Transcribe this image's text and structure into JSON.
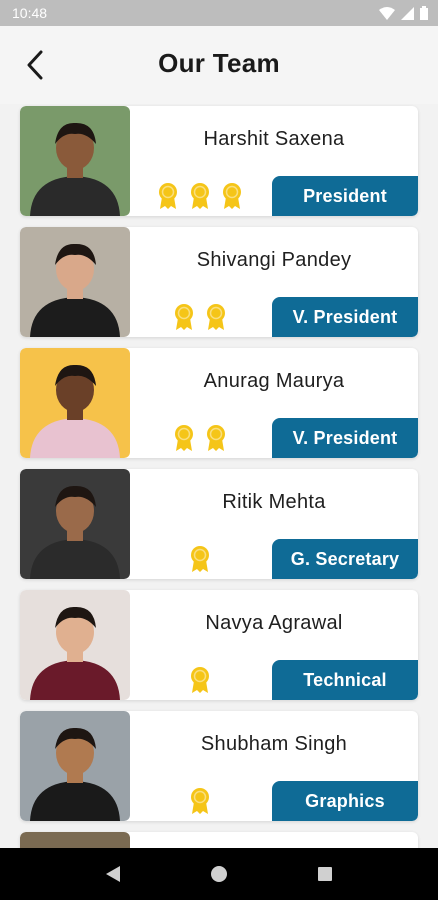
{
  "status_bar": {
    "time": "10:48"
  },
  "header": {
    "title": "Our Team"
  },
  "members": [
    {
      "name": "Harshit Saxena",
      "role": "President",
      "medals": 3,
      "photo_bg": "#7a9a6a",
      "shirt": "#2a2a2a",
      "skin": "#8a5a3a"
    },
    {
      "name": "Shivangi Pandey",
      "role": "V. President",
      "medals": 2,
      "photo_bg": "#b7b0a4",
      "shirt": "#1c1c1c",
      "skin": "#d9a88a"
    },
    {
      "name": "Anurag Maurya",
      "role": "V. President",
      "medals": 2,
      "photo_bg": "#f6c24a",
      "shirt": "#e8c2d0",
      "skin": "#6a4028"
    },
    {
      "name": "Ritik Mehta",
      "role": "G. Secretary",
      "medals": 1,
      "photo_bg": "#3a3a3a",
      "shirt": "#2b2b2b",
      "skin": "#9a6a4a"
    },
    {
      "name": "Navya Agrawal",
      "role": "Technical",
      "medals": 1,
      "photo_bg": "#e6dfdc",
      "shirt": "#6a1a2a",
      "skin": "#e0b090"
    },
    {
      "name": "Shubham Singh",
      "role": "Graphics",
      "medals": 1,
      "photo_bg": "#9aa2a8",
      "shirt": "#1a1a1a",
      "skin": "#b07a50"
    }
  ],
  "colors": {
    "accent": "#0f6b96",
    "medal": "#f5c518"
  },
  "icons": {
    "back": "chevron-left-icon",
    "medal": "medal-icon",
    "nav_back": "triangle-back-icon",
    "nav_home": "circle-home-icon",
    "nav_recents": "square-recents-icon"
  }
}
